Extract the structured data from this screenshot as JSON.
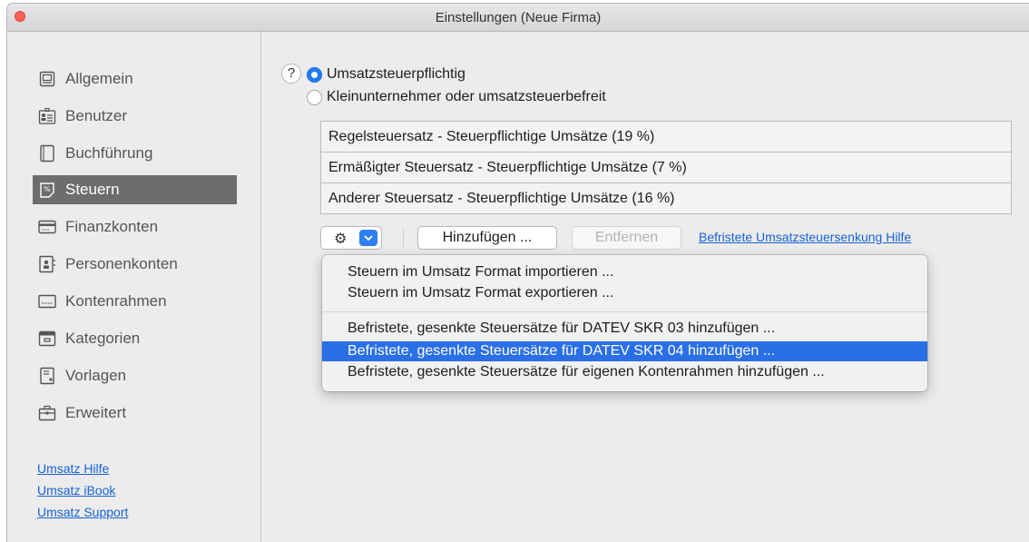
{
  "window": {
    "title": "Einstellungen (Neue Firma)"
  },
  "sidebar": {
    "items": [
      {
        "label": "Allgemein",
        "icon": "window-icon",
        "selected": false
      },
      {
        "label": "Benutzer",
        "icon": "users-icon",
        "selected": false
      },
      {
        "label": "Buchführung",
        "icon": "book-icon",
        "selected": false
      },
      {
        "label": "Steuern",
        "icon": "tax-icon",
        "selected": true
      },
      {
        "label": "Finanzkonten",
        "icon": "card-icon",
        "selected": false
      },
      {
        "label": "Personenkonten",
        "icon": "contacts-icon",
        "selected": false
      },
      {
        "label": "Kontenrahmen",
        "icon": "chart-of-accounts-icon",
        "selected": false
      },
      {
        "label": "Kategorien",
        "icon": "tray-icon",
        "selected": false
      },
      {
        "label": "Vorlagen",
        "icon": "template-icon",
        "selected": false
      },
      {
        "label": "Erweitert",
        "icon": "toolbox-icon",
        "selected": false
      }
    ],
    "links": [
      "Umsatz Hilfe",
      "Umsatz iBook",
      "Umsatz Support"
    ]
  },
  "main": {
    "help_label": "?",
    "radio_options": [
      {
        "label": "Umsatzsteuerpflichtig",
        "checked": true
      },
      {
        "label": "Kleinunternehmer oder umsatzsteuerbefreit",
        "checked": false
      }
    ],
    "tax_rates": [
      "Regelsteuersatz - Steuerpflichtige Umsätze (19 %)",
      "Ermäßigter Steuersatz - Steuerpflichtige Umsätze (7 %)",
      "Anderer Steuersatz - Steuerpflichtige Umsätze (16 %)"
    ],
    "toolbar": {
      "add_label": "Hinzufügen ...",
      "remove_label": "Entfernen",
      "help_link": "Befristete Umsatzsteuersenkung Hilfe"
    }
  },
  "menu": {
    "items": [
      {
        "label": "Steuern im Umsatz Format importieren ...",
        "highlighted": false
      },
      {
        "label": "Steuern im Umsatz Format exportieren ...",
        "highlighted": false
      },
      {
        "label": "Befristete, gesenkte Steuersätze für DATEV SKR 03 hinzufügen ...",
        "highlighted": false
      },
      {
        "label": "Befristete, gesenkte Steuersätze für DATEV SKR 04 hinzufügen ...",
        "highlighted": true
      },
      {
        "label": "Befristete, gesenkte Steuersätze für eigenen Kontenrahmen hinzufügen ...",
        "highlighted": false
      }
    ]
  },
  "colors": {
    "accent": "#2a6fe6",
    "selection_gray": "#6d6d6d",
    "link": "#1763d6"
  }
}
